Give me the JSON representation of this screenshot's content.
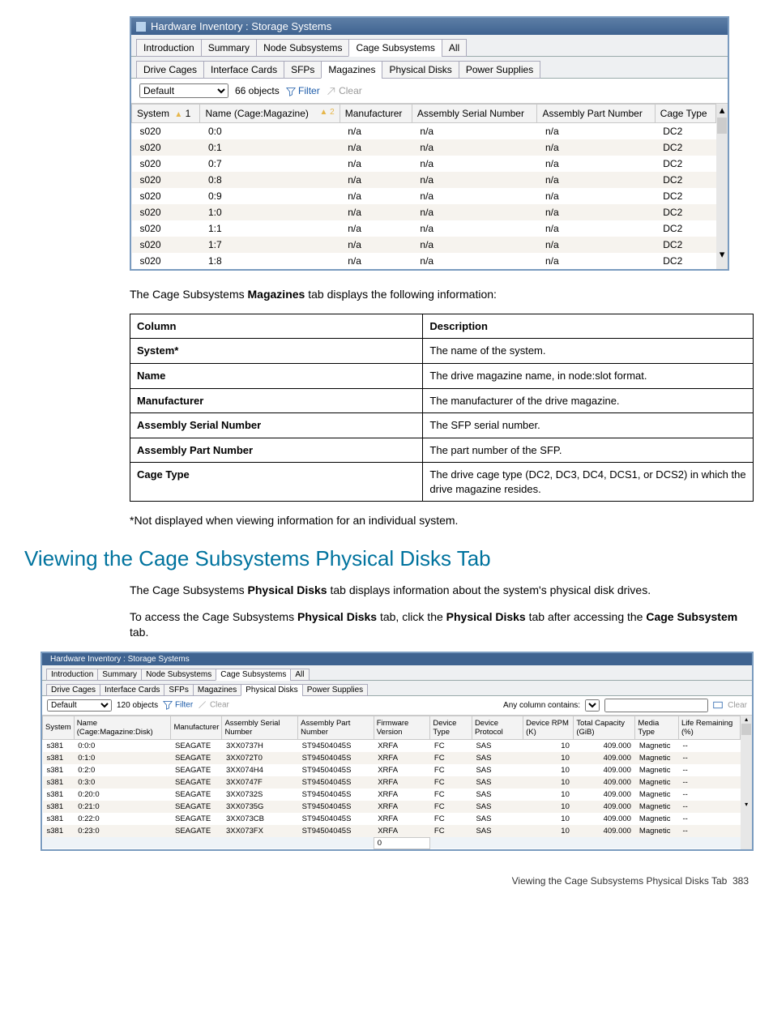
{
  "shot1": {
    "title": "Hardware Inventory : Storage Systems",
    "tabs1": [
      "Introduction",
      "Summary",
      "Node Subsystems",
      "Cage Subsystems",
      "All"
    ],
    "tabs1_active": 3,
    "tabs2": [
      "Drive Cages",
      "Interface Cards",
      "SFPs",
      "Magazines",
      "Physical Disks",
      "Power Supplies"
    ],
    "tabs2_active": 3,
    "filter": {
      "select": "Default",
      "count": "66 objects",
      "filter_label": "Filter",
      "clear_label": "Clear"
    },
    "columns": [
      "System",
      "Name (Cage:Magazine)",
      "Manufacturer",
      "Assembly Serial Number",
      "Assembly Part Number",
      "Cage Type"
    ],
    "sort1": "1",
    "sort2": "2",
    "rows": [
      {
        "system": "s020",
        "name": "0:0",
        "mfr": "n/a",
        "asn": "n/a",
        "apn": "n/a",
        "ct": "DC2"
      },
      {
        "system": "s020",
        "name": "0:1",
        "mfr": "n/a",
        "asn": "n/a",
        "apn": "n/a",
        "ct": "DC2"
      },
      {
        "system": "s020",
        "name": "0:7",
        "mfr": "n/a",
        "asn": "n/a",
        "apn": "n/a",
        "ct": "DC2"
      },
      {
        "system": "s020",
        "name": "0:8",
        "mfr": "n/a",
        "asn": "n/a",
        "apn": "n/a",
        "ct": "DC2"
      },
      {
        "system": "s020",
        "name": "0:9",
        "mfr": "n/a",
        "asn": "n/a",
        "apn": "n/a",
        "ct": "DC2"
      },
      {
        "system": "s020",
        "name": "1:0",
        "mfr": "n/a",
        "asn": "n/a",
        "apn": "n/a",
        "ct": "DC2"
      },
      {
        "system": "s020",
        "name": "1:1",
        "mfr": "n/a",
        "asn": "n/a",
        "apn": "n/a",
        "ct": "DC2"
      },
      {
        "system": "s020",
        "name": "1:7",
        "mfr": "n/a",
        "asn": "n/a",
        "apn": "n/a",
        "ct": "DC2"
      },
      {
        "system": "s020",
        "name": "1:8",
        "mfr": "n/a",
        "asn": "n/a",
        "apn": "n/a",
        "ct": "DC2"
      }
    ]
  },
  "doc": {
    "intro": "The Cage Subsystems <b>Magazines</b> tab displays the following information:",
    "desc_headers": [
      "Column",
      "Description"
    ],
    "desc_rows": [
      {
        "c": "System*",
        "d": "The name of the system."
      },
      {
        "c": "Name",
        "d": "The drive magazine name, in node:slot format."
      },
      {
        "c": "Manufacturer",
        "d": "The manufacturer of the drive magazine."
      },
      {
        "c": "Assembly Serial Number",
        "d": "The SFP serial number."
      },
      {
        "c": "Assembly Part Number",
        "d": "The part number of the SFP."
      },
      {
        "c": "Cage Type",
        "d": "The drive cage type (DC2, DC3, DC4, DCS1, or DCS2) in which the drive magazine resides."
      }
    ],
    "footnote": "*Not displayed when viewing information for an individual system.",
    "h2": "Viewing the Cage Subsystems Physical Disks Tab",
    "p1": "The Cage Subsystems <b>Physical Disks</b> tab displays information about the system's physical disk drives.",
    "p2": "To access the Cage Subsystems <b>Physical Disks</b> tab, click the <b>Physical Disks</b> tab after accessing the <b>Cage Subsystem</b> tab."
  },
  "shot2": {
    "title": "Hardware Inventory : Storage Systems",
    "tabs1": [
      "Introduction",
      "Summary",
      "Node Subsystems",
      "Cage Subsystems",
      "All"
    ],
    "tabs1_active": 3,
    "tabs2": [
      "Drive Cages",
      "Interface Cards",
      "SFPs",
      "Magazines",
      "Physical Disks",
      "Power Supplies"
    ],
    "tabs2_active": 4,
    "filter": {
      "select": "Default",
      "count": "120 objects",
      "filter_label": "Filter",
      "clear_label": "Clear",
      "search_label": "Any column contains:",
      "search_value": "",
      "clear_right": "Clear"
    },
    "columns": [
      "System",
      "Name (Cage:Magazine:Disk)",
      "Manufacturer",
      "Assembly Serial Number",
      "Assembly Part Number",
      "Firmware Version",
      "Device Type",
      "Device Protocol",
      "Device RPM (K)",
      "Total Capacity (GiB)",
      "Media Type",
      "Life Remaining (%)"
    ],
    "rows": [
      {
        "sys": "s381",
        "name": "0:0:0",
        "mfr": "SEAGATE",
        "asn": "3XX0737H",
        "apn": "ST94504045S",
        "fw": "XRFA",
        "dt": "FC",
        "dp": "SAS",
        "rpm": "10",
        "cap": "409.000",
        "mt": "Magnetic",
        "lr": "--"
      },
      {
        "sys": "s381",
        "name": "0:1:0",
        "mfr": "SEAGATE",
        "asn": "3XX072T0",
        "apn": "ST94504045S",
        "fw": "XRFA",
        "dt": "FC",
        "dp": "SAS",
        "rpm": "10",
        "cap": "409.000",
        "mt": "Magnetic",
        "lr": "--"
      },
      {
        "sys": "s381",
        "name": "0:2:0",
        "mfr": "SEAGATE",
        "asn": "3XX074H4",
        "apn": "ST94504045S",
        "fw": "XRFA",
        "dt": "FC",
        "dp": "SAS",
        "rpm": "10",
        "cap": "409.000",
        "mt": "Magnetic",
        "lr": "--"
      },
      {
        "sys": "s381",
        "name": "0:3:0",
        "mfr": "SEAGATE",
        "asn": "3XX0747F",
        "apn": "ST94504045S",
        "fw": "XRFA",
        "dt": "FC",
        "dp": "SAS",
        "rpm": "10",
        "cap": "409.000",
        "mt": "Magnetic",
        "lr": "--"
      },
      {
        "sys": "s381",
        "name": "0:20:0",
        "mfr": "SEAGATE",
        "asn": "3XX0732S",
        "apn": "ST94504045S",
        "fw": "XRFA",
        "dt": "FC",
        "dp": "SAS",
        "rpm": "10",
        "cap": "409.000",
        "mt": "Magnetic",
        "lr": "--"
      },
      {
        "sys": "s381",
        "name": "0:21:0",
        "mfr": "SEAGATE",
        "asn": "3XX0735G",
        "apn": "ST94504045S",
        "fw": "XRFA",
        "dt": "FC",
        "dp": "SAS",
        "rpm": "10",
        "cap": "409.000",
        "mt": "Magnetic",
        "lr": "--"
      },
      {
        "sys": "s381",
        "name": "0:22:0",
        "mfr": "SEAGATE",
        "asn": "3XX073CB",
        "apn": "ST94504045S",
        "fw": "XRFA",
        "dt": "FC",
        "dp": "SAS",
        "rpm": "10",
        "cap": "409.000",
        "mt": "Magnetic",
        "lr": "--"
      },
      {
        "sys": "s381",
        "name": "0:23:0",
        "mfr": "SEAGATE",
        "asn": "3XX073FX",
        "apn": "ST94504045S",
        "fw": "XRFA",
        "dt": "FC",
        "dp": "SAS",
        "rpm": "10",
        "cap": "409.000",
        "mt": "Magnetic",
        "lr": "--"
      }
    ],
    "status": "0"
  },
  "footer": {
    "label": "Viewing the Cage Subsystems Physical Disks Tab",
    "page": "383"
  }
}
